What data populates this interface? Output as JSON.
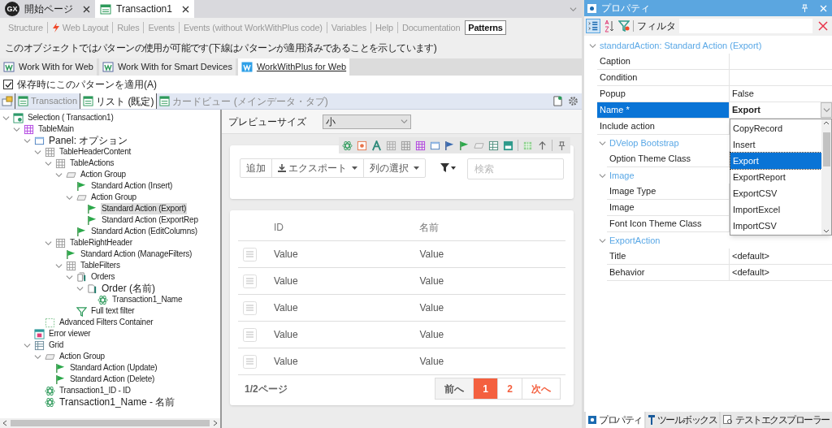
{
  "document_tabs": [
    {
      "kind": "start",
      "logo": "GX",
      "label": "開始ページ",
      "selected": false
    },
    {
      "kind": "object",
      "label": "Transaction1",
      "selected": true
    }
  ],
  "editor_tabs": [
    {
      "label": "Structure",
      "has_icon": false,
      "selected": false
    },
    {
      "label": "Web Layout",
      "has_icon": true,
      "selected": false
    },
    {
      "label": "Rules",
      "has_icon": false,
      "selected": false
    },
    {
      "label": "Events",
      "has_icon": false,
      "selected": false
    },
    {
      "label": "Events (without WorkWithPlus code)",
      "has_icon": false,
      "selected": false
    },
    {
      "label": "Variables",
      "has_icon": false,
      "selected": false
    },
    {
      "label": "Help",
      "has_icon": false,
      "selected": false
    },
    {
      "label": "Documentation",
      "has_icon": false,
      "selected": false
    },
    {
      "label": "Patterns",
      "has_icon": false,
      "selected": true
    }
  ],
  "info_text": "このオブジェクトではパターンの使用が可能です(下線はパターンが適用済みであることを示しています)",
  "pattern_tabs": [
    {
      "label": "Work With for Web",
      "applied": false,
      "selected": false
    },
    {
      "label": "Work With for Smart Devices",
      "applied": false,
      "selected": false
    },
    {
      "label": "WorkWithPlus for Web",
      "applied": true,
      "selected": true
    }
  ],
  "apply_on_save": {
    "label": "保存時にこのパターンを適用(A)",
    "checked": true
  },
  "instance_tabs": [
    {
      "label": "Transaction",
      "selected": false
    },
    {
      "label": "リスト (既定)",
      "selected": true
    },
    {
      "label": "カードビュー (メインデータ・タブ)",
      "selected": false
    }
  ],
  "tree": [
    {
      "label": "Selection ( Transaction1)",
      "kind": "selection",
      "selected": false,
      "expanded": true,
      "children": [
        {
          "label": "TableMain",
          "kind": "table_main",
          "selected": false,
          "expanded": true,
          "children": [
            {
              "label": "Panel: オプション",
              "kind": "panel",
              "selected": false,
              "expanded": true,
              "children": [
                {
                  "label": "TableHeaderContent",
                  "kind": "table",
                  "selected": false,
                  "expanded": true,
                  "children": [
                    {
                      "label": "TableActions",
                      "kind": "table",
                      "selected": false,
                      "expanded": true,
                      "children": [
                        {
                          "label": "Action Group",
                          "kind": "action_group",
                          "selected": false,
                          "expanded": true,
                          "children": [
                            {
                              "label": "Standard Action (Insert)",
                              "kind": "action",
                              "selected": false
                            },
                            {
                              "label": "Action Group",
                              "kind": "action_group",
                              "selected": false,
                              "expanded": true,
                              "children": [
                                {
                                  "label": "Standard Action (Export)",
                                  "kind": "action",
                                  "selected": true
                                },
                                {
                                  "label": "Standard Action (ExportRep",
                                  "kind": "action",
                                  "selected": false
                                }
                              ]
                            },
                            {
                              "label": "Standard Action (EditColumns)",
                              "kind": "action",
                              "selected": false
                            }
                          ]
                        }
                      ]
                    },
                    {
                      "label": "TableRightHeader",
                      "kind": "table",
                      "selected": false,
                      "expanded": true,
                      "children": [
                        {
                          "label": "Standard Action (ManageFilters)",
                          "kind": "action",
                          "selected": false
                        },
                        {
                          "label": "TableFilters",
                          "kind": "table",
                          "selected": false,
                          "expanded": true,
                          "children": [
                            {
                              "label": "Orders",
                              "kind": "orders",
                              "selected": false,
                              "expanded": true,
                              "children": [
                                {
                                  "label": "Order (名前)",
                                  "kind": "order",
                                  "selected": false,
                                  "expanded": true,
                                  "children": [
                                    {
                                      "label": "Transaction1_Name",
                                      "kind": "attribute",
                                      "selected": false
                                    }
                                  ]
                                }
                              ]
                            },
                            {
                              "label": "Full text filter",
                              "kind": "filter",
                              "selected": false
                            }
                          ]
                        }
                      ]
                    }
                  ]
                },
                {
                  "label": "Advanced Filters Container",
                  "kind": "container",
                  "selected": false
                }
              ]
            },
            {
              "label": "Error viewer",
              "kind": "error",
              "selected": false
            },
            {
              "label": "Grid",
              "kind": "grid",
              "selected": false,
              "expanded": true,
              "children": [
                {
                  "label": "Action Group",
                  "kind": "action_group",
                  "selected": false,
                  "expanded": true,
                  "children": [
                    {
                      "label": "Standard Action (Update)",
                      "kind": "action",
                      "selected": false
                    },
                    {
                      "label": "Standard Action (Delete)",
                      "kind": "action",
                      "selected": false
                    }
                  ]
                },
                {
                  "label": "Transaction1_ID - ID",
                  "kind": "attribute",
                  "selected": false
                },
                {
                  "label": "Transaction1_Name  - 名前",
                  "kind": "attribute",
                  "selected": false
                }
              ]
            }
          ]
        }
      ]
    }
  ],
  "preview": {
    "size_label": "プレビューサイズ",
    "size_value": "小",
    "actions": [
      {
        "label": "追加",
        "kind": "plain"
      },
      {
        "label": "エクスポート",
        "kind": "export"
      },
      {
        "label": "列の選択",
        "kind": "menu"
      }
    ],
    "search": {
      "placeholder": "検索"
    },
    "table": {
      "columns": [
        "ID",
        "名前"
      ],
      "rows": [
        [
          "Value",
          "Value"
        ],
        [
          "Value",
          "Value"
        ],
        [
          "Value",
          "Value"
        ],
        [
          "Value",
          "Value"
        ],
        [
          "Value",
          "Value"
        ]
      ]
    },
    "page_info": "1/2ページ",
    "pager": [
      {
        "label": "前へ",
        "kind": "prev",
        "selected": false
      },
      {
        "label": "1",
        "kind": "page",
        "selected": true
      },
      {
        "label": "2",
        "kind": "page",
        "selected": false
      },
      {
        "label": "次へ",
        "kind": "next",
        "selected": false
      }
    ]
  },
  "properties": {
    "title": "プロパティ",
    "filter_label": "フィルタ",
    "group": {
      "title": "standardAction: Standard Action (Export)",
      "expanded": true,
      "rows": [
        {
          "kind": "property",
          "name": "Caption",
          "selected": false
        },
        {
          "kind": "property",
          "name": "Condition",
          "selected": false
        },
        {
          "kind": "property",
          "name": "Popup",
          "value": "False",
          "selected": false
        },
        {
          "kind": "property",
          "name": "Name *",
          "value": "Export",
          "selected": true,
          "dropdown": [
            {
              "label": "CopyRecord",
              "selected": false
            },
            {
              "label": "Insert",
              "selected": false
            },
            {
              "label": "Export",
              "selected": true
            },
            {
              "label": "ExportReport",
              "selected": false
            },
            {
              "label": "ExportCSV",
              "selected": false
            },
            {
              "label": "ImportExcel",
              "selected": false
            },
            {
              "label": "ImportCSV",
              "selected": false
            }
          ]
        },
        {
          "kind": "property",
          "name": "Include action",
          "selected": false
        },
        {
          "kind": "group",
          "title": "DVelop Bootstrap",
          "expanded": true,
          "rows": [
            {
              "kind": "property",
              "name": "Option Theme Class",
              "selected": false
            }
          ]
        },
        {
          "kind": "group",
          "title": "Image",
          "expanded": true,
          "rows": [
            {
              "kind": "property",
              "name": "Image Type",
              "selected": false
            },
            {
              "kind": "property",
              "name": "Image",
              "selected": false
            },
            {
              "kind": "property",
              "name": "Font Icon Theme Class",
              "selected": false
            }
          ]
        },
        {
          "kind": "group",
          "title": "ExportAction",
          "expanded": true,
          "rows": [
            {
              "kind": "property",
              "name": "Title",
              "value": "<default>",
              "selected": false
            },
            {
              "kind": "property",
              "name": "Behavior",
              "value": "<default>",
              "selected": false
            }
          ]
        }
      ]
    }
  },
  "bottom_tabs": [
    {
      "label": "プロパティ",
      "kind": "properties",
      "selected": true
    },
    {
      "label": "ツールボックス",
      "kind": "toolbox",
      "selected": false
    },
    {
      "label": "テストエクスプローラー",
      "kind": "explorer",
      "selected": false
    }
  ]
}
